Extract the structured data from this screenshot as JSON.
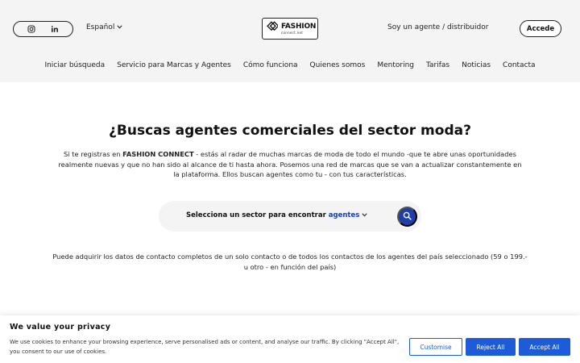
{
  "header": {
    "language": "Español",
    "logo_main": "FASHION",
    "logo_sub": "connect.net",
    "agent_link": "Soy un agente / distribuidor",
    "login_label": "Accede"
  },
  "nav": {
    "items": [
      {
        "label": "Iniciar búsqueda"
      },
      {
        "label": "Servicio para Marcas y Agentes"
      },
      {
        "label": "Cómo funciona"
      },
      {
        "label": "Quienes somos"
      },
      {
        "label": "Mentoring"
      },
      {
        "label": "Tarifas"
      },
      {
        "label": "Noticias"
      },
      {
        "label": "Contacta"
      }
    ]
  },
  "main": {
    "title": "¿Buscas agentes comerciales del sector moda?",
    "intro_before": "Si te registras en ",
    "intro_brand": "FASHION CONNECT",
    "intro_after": " - estás al radar de muchas marcas de moda de todo el mundo -que te abre unas oportunidades realmente nuevas y que no han sido al alcance de ti hasta ahora. Posemos una red de marcas que se van a actualizar constantemente en la plataforma. Ellos buscan agentes como tu - con tus características.",
    "search_label": "Selecciona un sector para encontrar",
    "search_sector": "agentes",
    "contact_note": "Puede adquirir los datos de contacto completos de un solo contacto o de todos los contactos de los agentes del país seleccionado (59 o 199.- u otro - en función del país)"
  },
  "cookie": {
    "title": "We value your privacy",
    "text": "We use cookies to enhance your browsing experience, serve personalised ads or content, and analyse our traffic. By clicking \"Accept All\", you consent to our use of cookies.",
    "customise_label": "Customise",
    "reject_label": "Reject All",
    "accept_label": "Accept All"
  },
  "colors": {
    "accent": "#1e3fa8",
    "cookie_button": "#1e5bd8",
    "header_bg": "#f4f4f4"
  }
}
